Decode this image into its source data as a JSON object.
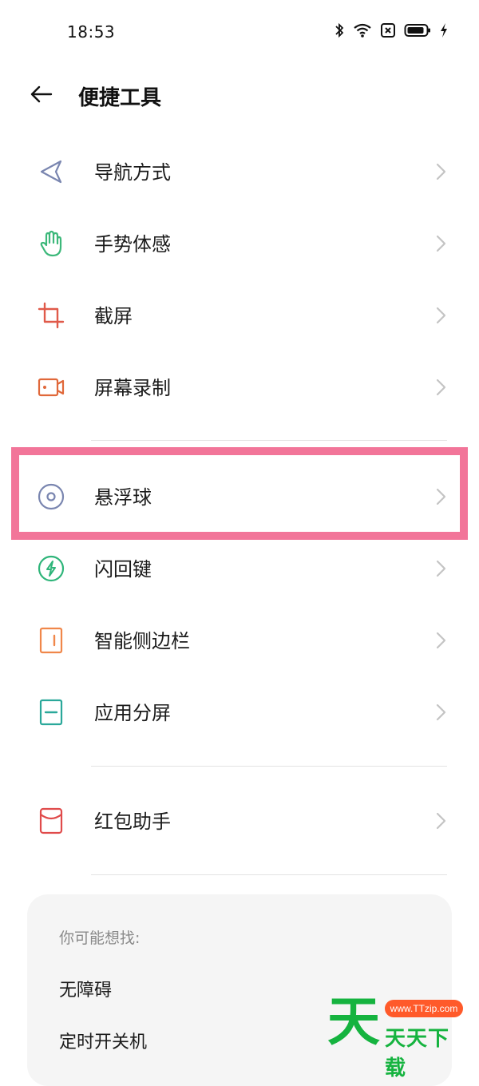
{
  "status_bar": {
    "time": "18:53",
    "icons": [
      "bluetooth-icon",
      "wifi-icon",
      "sim-off-icon",
      "battery-icon",
      "charging-icon"
    ]
  },
  "header": {
    "title": "便捷工具",
    "back_icon": "arrow-left-icon"
  },
  "items": [
    {
      "label": "导航方式",
      "icon": "navigation-icon",
      "color": "#7a86b0"
    },
    {
      "label": "手势体感",
      "icon": "hand-icon",
      "color": "#3cb87a"
    },
    {
      "label": "截屏",
      "icon": "crop-icon",
      "color": "#e05a4a"
    },
    {
      "label": "屏幕录制",
      "icon": "video-record-icon",
      "color": "#e0683a"
    },
    {
      "label": "悬浮球",
      "icon": "floating-ball-icon",
      "color": "#7a86b0"
    },
    {
      "label": "闪回键",
      "icon": "flash-back-icon",
      "color": "#2fb57a"
    },
    {
      "label": "智能侧边栏",
      "icon": "sidebar-icon",
      "color": "#f0874a"
    },
    {
      "label": "应用分屏",
      "icon": "split-screen-icon",
      "color": "#2aa89a"
    },
    {
      "label": "红包助手",
      "icon": "red-envelope-icon",
      "color": "#e04b4b"
    }
  ],
  "highlight_color": "#f27599",
  "suggestions": {
    "title": "你可能想找:",
    "items": [
      "无障碍",
      "定时开关机"
    ]
  },
  "watermark": {
    "big_char": "天",
    "url": "www.TTzip.com",
    "text": "天天下载"
  }
}
